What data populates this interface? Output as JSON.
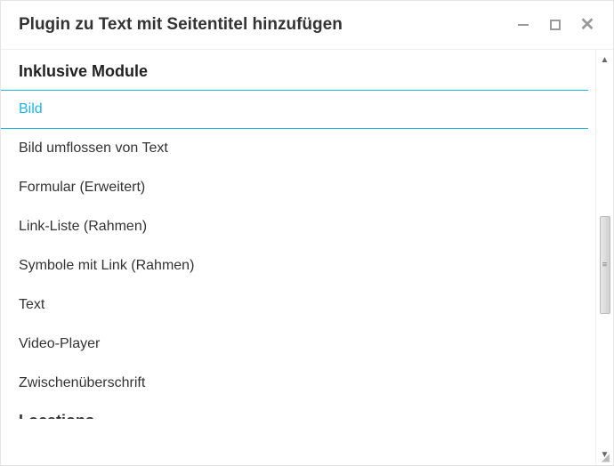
{
  "dialog": {
    "title": "Plugin zu Text mit Seitentitel hinzufügen"
  },
  "section": {
    "header": "Inklusive Module"
  },
  "items": [
    {
      "label": "Bild",
      "highlighted": true
    },
    {
      "label": "Bild umflossen von Text",
      "highlighted": false
    },
    {
      "label": "Formular (Erweitert)",
      "highlighted": false
    },
    {
      "label": "Link-Liste (Rahmen)",
      "highlighted": false
    },
    {
      "label": "Symbole mit Link (Rahmen)",
      "highlighted": false
    },
    {
      "label": "Text",
      "highlighted": false
    },
    {
      "label": "Video-Player",
      "highlighted": false
    },
    {
      "label": "Zwischenüberschrift",
      "highlighted": false
    }
  ],
  "partial": {
    "label": "Locations"
  }
}
